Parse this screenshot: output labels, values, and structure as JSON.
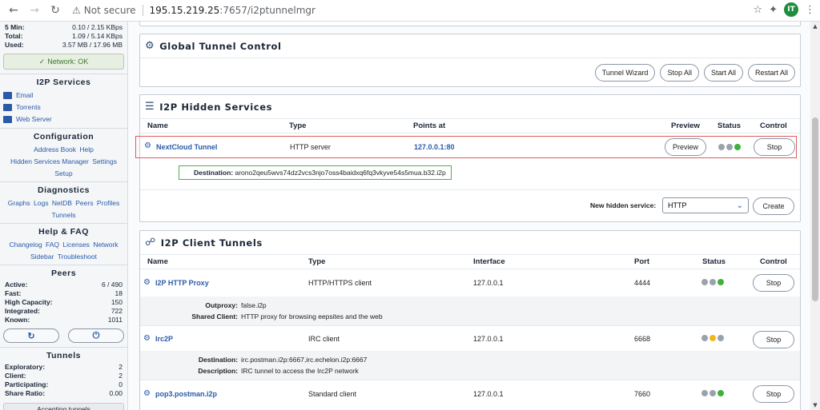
{
  "browser": {
    "security_label": "Not secure",
    "url_host": "195.15.219.25",
    "url_path": ":7657/i2ptunnelmgr",
    "avatar_initials": "IT"
  },
  "sidebar": {
    "bandwidth": [
      {
        "label": "5 Min:",
        "value": "0.10 / 2.15 KBps"
      },
      {
        "label": "Total:",
        "value": "1.09 / 5.14 KBps"
      },
      {
        "label": "Used:",
        "value": "3.57 MB / 17.96 MB"
      }
    ],
    "network_status": "Network: OK",
    "services_title": "I2P Services",
    "services": [
      "Email",
      "Torrents",
      "Web Server"
    ],
    "config_title": "Configuration",
    "config_links": [
      "Address Book",
      "Help",
      "Hidden Services Manager",
      "Settings",
      "Setup"
    ],
    "diag_title": "Diagnostics",
    "diag_links": [
      "Graphs",
      "Logs",
      "NetDB",
      "Peers",
      "Profiles",
      "Tunnels"
    ],
    "help_title": "Help & FAQ",
    "help_links": [
      "Changelog",
      "FAQ",
      "Licenses",
      "Network",
      "Sidebar",
      "Troubleshoot"
    ],
    "peers_title": "Peers",
    "peers": [
      {
        "label": "Active:",
        "value": "6 / 490"
      },
      {
        "label": "Fast:",
        "value": "18"
      },
      {
        "label": "High Capacity:",
        "value": "150"
      },
      {
        "label": "Integrated:",
        "value": "722"
      },
      {
        "label": "Known:",
        "value": "1011"
      }
    ],
    "tunnels_title": "Tunnels",
    "tunnels": [
      {
        "label": "Exploratory:",
        "value": "2"
      },
      {
        "label": "Client:",
        "value": "2"
      },
      {
        "label": "Participating:",
        "value": "0"
      },
      {
        "label": "Share Ratio:",
        "value": "0.00"
      }
    ],
    "accepting": "Accepting tunnels"
  },
  "global": {
    "title": "Global Tunnel Control",
    "buttons": [
      "Tunnel Wizard",
      "Stop All",
      "Start All",
      "Restart All"
    ]
  },
  "hidden": {
    "title": "I2P Hidden Services",
    "headers": [
      "Name",
      "Type",
      "Points at",
      "Preview",
      "Status",
      "Control"
    ],
    "service": {
      "name": "NextCloud Tunnel",
      "type": "HTTP server",
      "points_at": "127.0.0.1:80",
      "preview": "Preview",
      "control": "Stop",
      "destination_label": "Destination:",
      "destination": "arono2qeu5wvs74dz2vcs3njo7oss4baidxq6fq3vkyve54s5mua.b32.i2p"
    },
    "new_label": "New hidden service:",
    "new_value": "HTTP",
    "create": "Create"
  },
  "client": {
    "title": "I2P Client Tunnels",
    "headers": [
      "Name",
      "Type",
      "Interface",
      "Port",
      "Status",
      "Control"
    ],
    "tunnels": [
      {
        "name": "I2P HTTP Proxy",
        "type": "HTTP/HTTPS client",
        "interface": "127.0.0.1",
        "port": "4444",
        "control": "Stop",
        "d1_label": "Outproxy:",
        "d1": "false.i2p",
        "d2_label": "Shared Client:",
        "d2": "HTTP proxy for browsing eepsites and the web"
      },
      {
        "name": "Irc2P",
        "type": "IRC client",
        "interface": "127.0.0.1",
        "port": "6668",
        "control": "Stop",
        "d1_label": "Destination:",
        "d1": "irc.postman.i2p:6667,irc.echelon.i2p:6667",
        "d2_label": "Description:",
        "d2": "IRC tunnel to access the Irc2P network"
      },
      {
        "name": "pop3.postman.i2p",
        "type": "Standard client",
        "interface": "127.0.0.1",
        "port": "7660",
        "control": "Stop"
      }
    ]
  },
  "colors": {
    "accent": "#2a5aa8",
    "highlight_red": "#e05a5a",
    "highlight_green": "#4caf50",
    "status_green": "#3eb13a",
    "status_yellow": "#f2b71c"
  }
}
